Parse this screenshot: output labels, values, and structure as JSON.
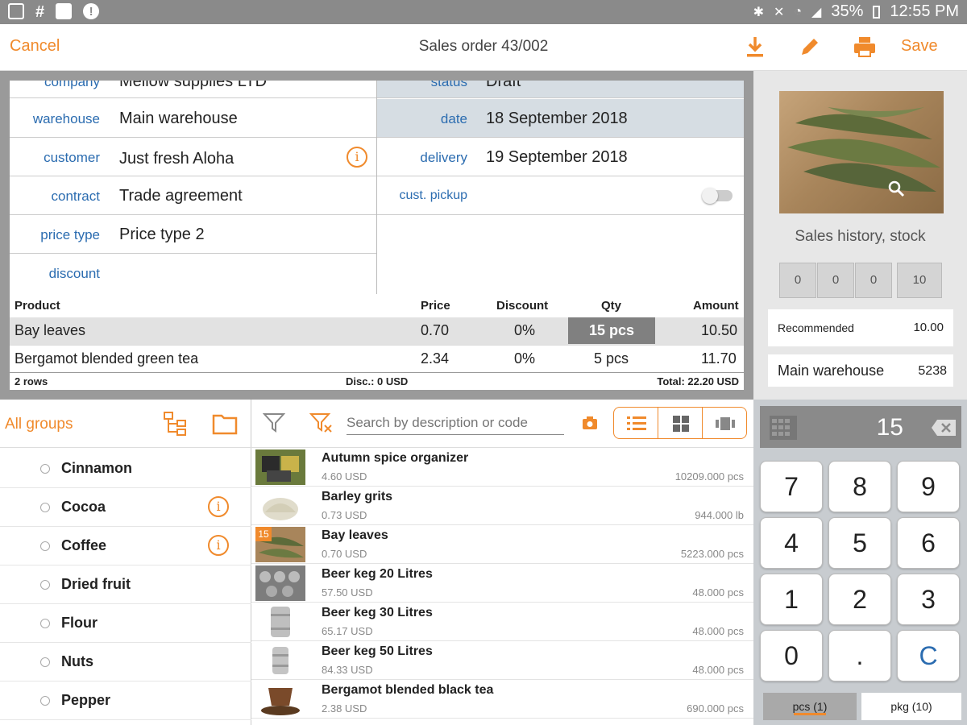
{
  "status_bar": {
    "battery": "35%",
    "time": "12:55 PM"
  },
  "action_bar": {
    "cancel_label": "Cancel",
    "title": "Sales order 43/002",
    "save_label": "Save"
  },
  "form": {
    "company_label": "company",
    "company_value": "Mellow supplies LTD",
    "warehouse_label": "warehouse",
    "warehouse_value": "Main warehouse",
    "customer_label": "customer",
    "customer_value": "Just fresh Aloha",
    "contract_label": "contract",
    "contract_value": "Trade agreement",
    "price_type_label": "price type",
    "price_type_value": "Price type 2",
    "discount_label": "discount",
    "discount_value": "",
    "status_label": "status",
    "status_value": "Draft",
    "date_label": "date",
    "date_value": "18 September 2018",
    "delivery_label": "delivery",
    "delivery_value": "19 September 2018",
    "pickup_label": "cust. pickup"
  },
  "lines": {
    "headers": {
      "product": "Product",
      "price": "Price",
      "discount": "Discount",
      "qty": "Qty",
      "amount": "Amount"
    },
    "rows": [
      {
        "product": "Bay leaves",
        "price": "0.70",
        "discount": "0%",
        "qty": "15 pcs",
        "amount": "10.50"
      },
      {
        "product": "Bergamot blended green tea",
        "price": "2.34",
        "discount": "0%",
        "qty": "5 pcs",
        "amount": "11.70"
      }
    ],
    "row_count": "2 rows",
    "disc_total": "Disc.: 0 USD",
    "total": "Total: 22.20 USD"
  },
  "info": {
    "history_label": "Sales history, stock",
    "stock_values": [
      "0",
      "0",
      "0",
      "10"
    ],
    "recommended_label": "Recommended",
    "recommended_value": "10.00",
    "warehouse_label": "Main warehouse",
    "warehouse_value": "5238"
  },
  "groups": {
    "title": "All groups",
    "items": [
      {
        "name": "Cinnamon"
      },
      {
        "name": "Cocoa"
      },
      {
        "name": "Coffee"
      },
      {
        "name": "Dried fruit"
      },
      {
        "name": "Flour"
      },
      {
        "name": "Nuts"
      },
      {
        "name": "Pepper"
      }
    ]
  },
  "search": {
    "placeholder": "Search by description or code"
  },
  "products": [
    {
      "name": "Autumn spice organizer",
      "price": "4.60 USD",
      "stock": "10209.000 pcs"
    },
    {
      "name": "Barley grits",
      "price": "0.73 USD",
      "stock": "944.000 lb"
    },
    {
      "name": "Bay leaves",
      "price": "0.70 USD",
      "stock": "5223.000 pcs",
      "badge": "15"
    },
    {
      "name": "Beer keg 20 Litres",
      "price": "57.50 USD",
      "stock": "48.000 pcs"
    },
    {
      "name": "Beer keg 30 Litres",
      "price": "65.17 USD",
      "stock": "48.000 pcs"
    },
    {
      "name": "Beer keg 50 Litres",
      "price": "84.33 USD",
      "stock": "48.000 pcs"
    },
    {
      "name": "Bergamot blended black tea",
      "price": "2.38 USD",
      "stock": "690.000 pcs"
    }
  ],
  "keypad": {
    "value": "15",
    "keys": [
      "7",
      "8",
      "9",
      "4",
      "5",
      "6",
      "1",
      "2",
      "3",
      "0",
      ".",
      "C"
    ],
    "unit_pcs": "pcs (1)",
    "unit_pkg": "pkg (10)"
  },
  "colors": {
    "accent": "#f08a2c",
    "label_blue": "#2b6cb0",
    "selected_qty": "#808080"
  }
}
